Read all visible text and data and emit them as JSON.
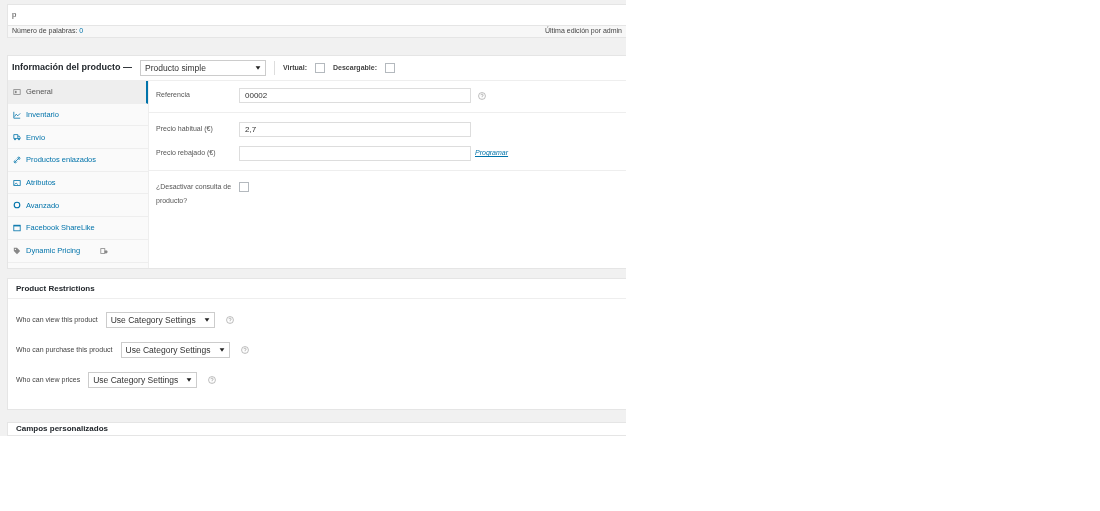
{
  "editor": {
    "text": "p",
    "word_count_label": "Número de palabras:",
    "word_count": "0",
    "last_edit": "Última edición por admin"
  },
  "product_data": {
    "title": "Información del producto —",
    "product_type": "Producto simple",
    "options": [
      {
        "label": "Virtual:",
        "checked": false
      },
      {
        "label": "Descargable:",
        "checked": false
      }
    ],
    "tabs": [
      {
        "label": "General",
        "selected": true
      },
      {
        "label": "Inventario",
        "selected": false
      },
      {
        "label": "Envío",
        "selected": false
      },
      {
        "label": "Productos enlazados",
        "selected": false
      },
      {
        "label": "Atributos",
        "selected": false
      },
      {
        "label": "Avanzado",
        "selected": false
      },
      {
        "label": "Facebook ShareLike",
        "selected": false
      },
      {
        "label": "Dynamic Pricing",
        "selected": false
      }
    ],
    "fields": [
      {
        "kind": "text",
        "label": "Referencia",
        "value": "00002"
      },
      {
        "kind": "text",
        "label": "Precio habitual (€)",
        "value": "2,7"
      },
      {
        "kind": "text",
        "label": "Precio rebajado (€)",
        "link": "Programar"
      },
      {
        "kind": "checkbox",
        "label": "¿Desactivar consulta de producto?",
        "checked": false
      }
    ]
  },
  "restrictions": {
    "title": "Product Restrictions",
    "rows": [
      {
        "label": "Who can view this product",
        "value": "Use Category Settings"
      },
      {
        "label": "Who can purchase this product",
        "value": "Use Category Settings"
      },
      {
        "label": "Who can view prices",
        "value": "Use Category Settings"
      }
    ]
  },
  "custom_fields": {
    "title": "Campos personalizados"
  }
}
